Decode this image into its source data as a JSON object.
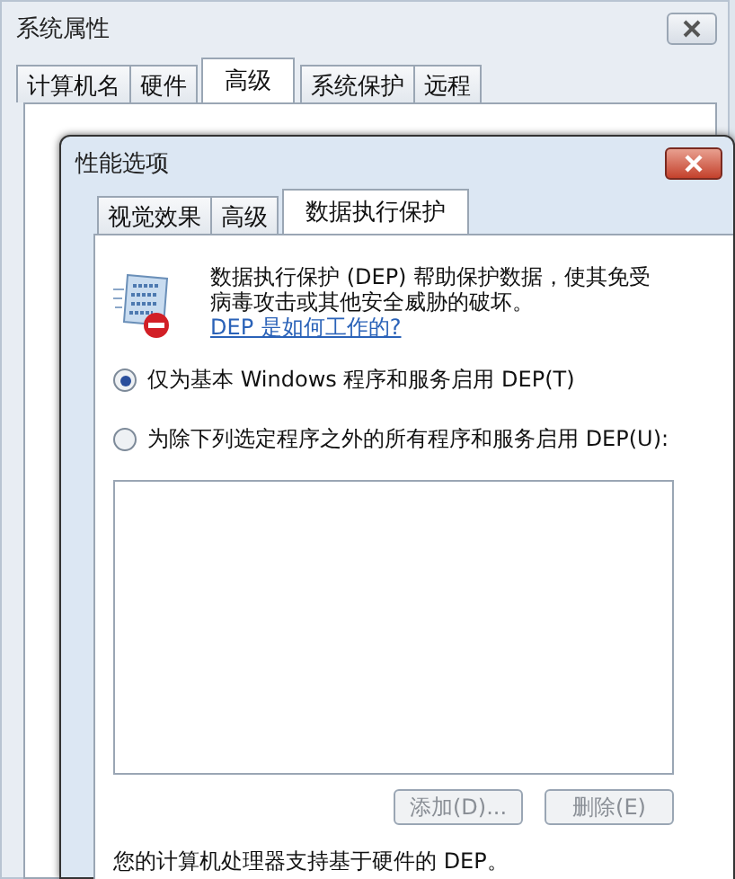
{
  "back_window": {
    "title": "系统属性",
    "tabs": [
      {
        "label": "计算机名",
        "selected": false
      },
      {
        "label": "硬件",
        "selected": false
      },
      {
        "label": "高级",
        "selected": true
      },
      {
        "label": "系统保护",
        "selected": false
      },
      {
        "label": "远程",
        "selected": false
      }
    ]
  },
  "dialog": {
    "title": "性能选项",
    "tabs": [
      {
        "label": "视觉效果",
        "selected": false
      },
      {
        "label": "高级",
        "selected": false
      },
      {
        "label": "数据执行保护",
        "selected": true
      }
    ],
    "description": "数据执行保护 (DEP) 帮助保护数据，使其免受病毒攻击或其他安全威胁的破坏。",
    "link": "DEP 是如何工作的?",
    "options": [
      {
        "label": "仅为基本 Windows 程序和服务启用 DEP(T)",
        "selected": true
      },
      {
        "label": "为除下列选定程序之外的所有程序和服务启用 DEP(U):",
        "selected": false
      }
    ],
    "buttons": [
      {
        "label": "添加(D)...",
        "disabled": true
      },
      {
        "label": "删除(E)",
        "disabled": true
      }
    ],
    "footer": "您的计算机处理器支持基于硬件的 DEP。"
  }
}
